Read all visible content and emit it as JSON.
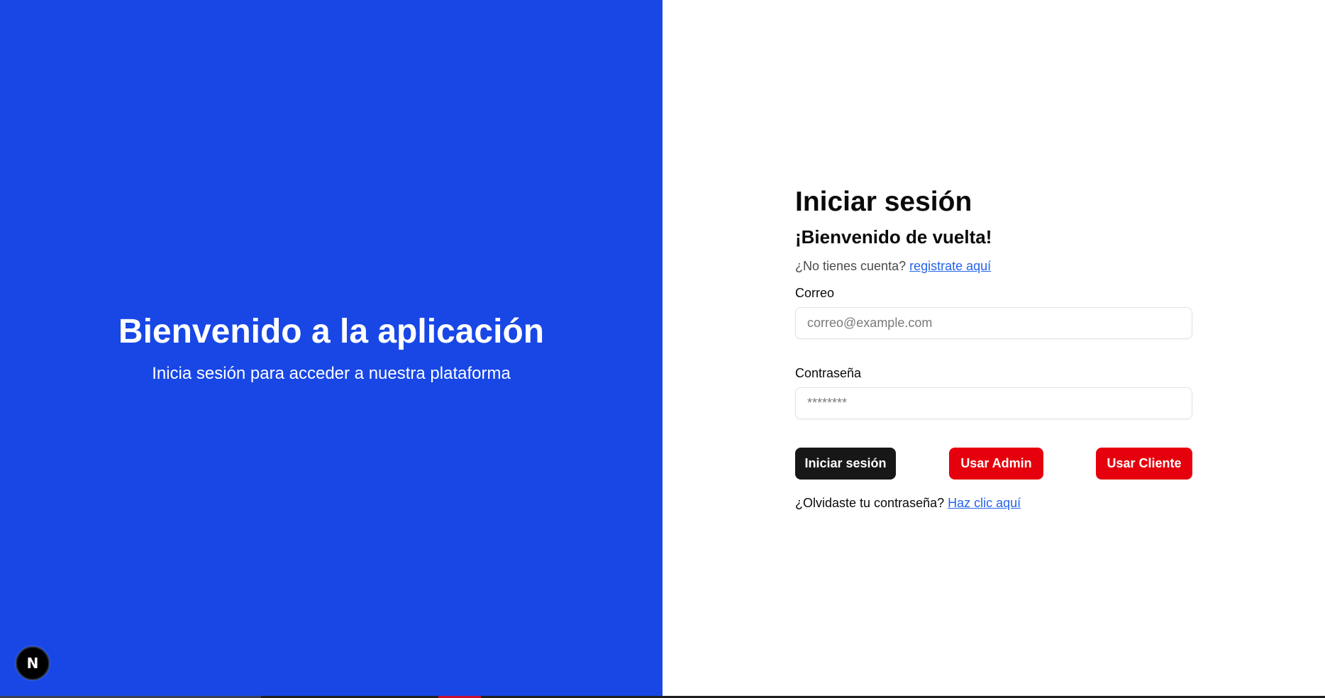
{
  "hero": {
    "title": "Bienvenido a la aplicación",
    "subtitle": "Inicia sesión para acceder a nuestra plataforma"
  },
  "login": {
    "title": "Iniciar sesión",
    "subtitle": "¡Bienvenido de vuelta!",
    "register_prompt": "¿No tienes cuenta?",
    "register_link": "registrate aquí",
    "email": {
      "label": "Correo",
      "placeholder": "correo@example.com",
      "value": ""
    },
    "password": {
      "label": "Contraseña",
      "placeholder": "********",
      "value": ""
    },
    "buttons": {
      "submit": "Iniciar sesión",
      "use_admin": "Usar Admin",
      "use_client": "Usar Cliente"
    },
    "forgot_prompt": "¿Olvidaste tu contraseña?",
    "forgot_link": "Haz clic aquí"
  },
  "badge": {
    "letter": "N",
    "icon": "nextjs-logo-icon"
  },
  "colors": {
    "hero_background": "#1847e6",
    "primary_button": "#171717",
    "quick_login_buttons": "#e6000d",
    "link": "#2563eb"
  }
}
